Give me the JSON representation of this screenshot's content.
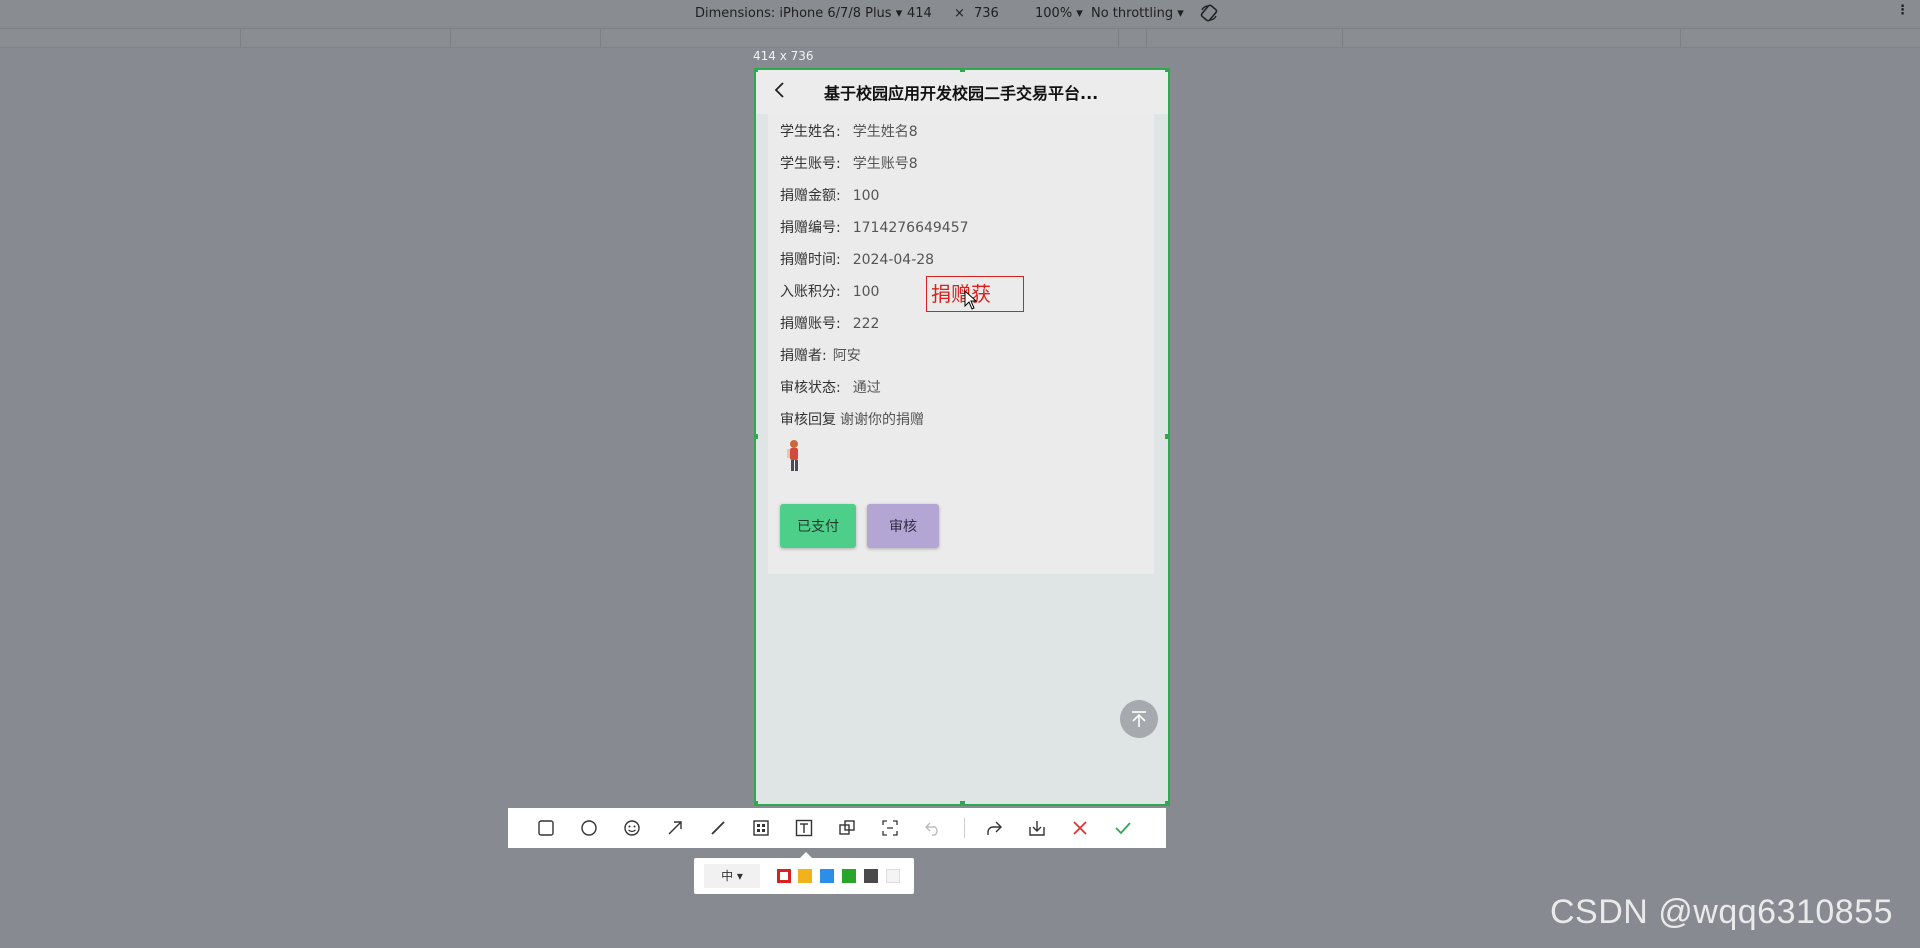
{
  "devtools": {
    "dimensions_label": "Dimensions: iPhone 6/7/8 Plus",
    "width_value": "414",
    "times": "×",
    "height_value": "736",
    "zoom": "100%",
    "throttling": "No throttling",
    "viewport_size": "414 x 736"
  },
  "app": {
    "title": "基于校园应用开发校园二手交易平台...",
    "fields": [
      {
        "label": "学生姓名:",
        "value": "学生姓名8"
      },
      {
        "label": "学生账号:",
        "value": "学生账号8"
      },
      {
        "label": "捐赠金额:",
        "value": "100"
      },
      {
        "label": "捐赠编号:",
        "value": "1714276649457"
      },
      {
        "label": "捐赠时间:",
        "value": "2024-04-28"
      },
      {
        "label": "入账积分:",
        "value": "100"
      },
      {
        "label": "捐赠账号:",
        "value": "222"
      },
      {
        "label": "捐赠者:",
        "value": "阿安"
      },
      {
        "label": "审核状态:",
        "value": "通过"
      },
      {
        "label": "审核回复",
        "value": "谢谢你的捐赠"
      }
    ],
    "paid_button": "已支付",
    "audit_button": "审核"
  },
  "annotation_text": "捐赠获",
  "color_panel": {
    "size_label": "中",
    "swatches": [
      "#d9221d",
      "#f2b21b",
      "#2b8ee8",
      "#2aa52c",
      "#4a4a4a",
      "#f4f4f4"
    ]
  },
  "watermark": "CSDN @wqq6310855"
}
